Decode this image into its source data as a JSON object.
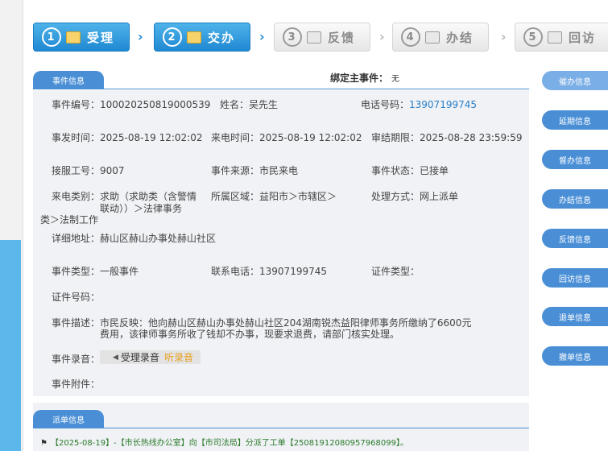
{
  "steps": [
    {
      "num": "1",
      "label": "受理",
      "state": "active"
    },
    {
      "num": "2",
      "label": "交办",
      "state": "active"
    },
    {
      "num": "3",
      "label": "反馈",
      "state": "inactive"
    },
    {
      "num": "4",
      "label": "办结",
      "state": "inactive"
    },
    {
      "num": "5",
      "label": "回访",
      "state": "inactive"
    }
  ],
  "arrow_glyph": "›",
  "sections": {
    "event_info": "事件信息",
    "dispatch_info": "派单信息"
  },
  "binding": {
    "label": "绑定主事件：",
    "value": "无"
  },
  "fields": {
    "event_no": {
      "label": "事件编号：",
      "value": "100020250819000539"
    },
    "name": {
      "label": "姓名：",
      "value": "吴先生"
    },
    "phone": {
      "label": "电话号码：",
      "value": "13907199745"
    },
    "event_time": {
      "label": "事发时间：",
      "value": "2025-08-19 12:02:02"
    },
    "call_time": {
      "label": "来电时间：",
      "value": "2025-08-19 12:02:02"
    },
    "deadline": {
      "label": "审结期限：",
      "value": "2025-08-28 23:59:59"
    },
    "agent_no": {
      "label": "接服工号：",
      "value": "9007"
    },
    "source": {
      "label": "事件来源：",
      "value": "市民来电"
    },
    "status": {
      "label": "事件状态：",
      "value": "已接单"
    },
    "call_type": {
      "label": "来电类别：",
      "value1": "求助（求助类（含警情",
      "value2": "联动））＞法律事务",
      "value3": "类＞法制工作"
    },
    "area": {
      "label": "所属区域：",
      "value1": "益阳市＞市辖区＞"
    },
    "handle_mode": {
      "label": "处理方式：",
      "value": "网上派单"
    },
    "address": {
      "label": "详细地址：",
      "value": "赫山区赫山办事处赫山社区"
    },
    "event_type": {
      "label": "事件类型：",
      "value": "一般事件"
    },
    "contact_phone": {
      "label": "联系电话：",
      "value": "13907199745"
    },
    "id_type": {
      "label": "证件类型：",
      "value": ""
    },
    "id_no": {
      "label": "证件号码：",
      "value": ""
    },
    "description": {
      "label": "事件描述：",
      "line1": "市民反映：他向赫山区赫山办事处赫山社区204湖南锐杰益阳律师事务所缴纳了6600元",
      "line2": "费用，该律师事务所收了钱却不办事，现要求退费，请部门核实处理。"
    },
    "recording": {
      "label": "事件录音：",
      "button": "受理录音",
      "listen": "听录音"
    },
    "attachment": {
      "label": "事件附件：",
      "value": ""
    }
  },
  "dispatch_log": "【2025-08-19】-【市长热线办公室】向【市司法局】分派了工单【25081912080957968099】。",
  "right_buttons": [
    "催办信息",
    "延期信息",
    "督办信息",
    "办结信息",
    "反馈信息",
    "回访信息",
    "退单信息",
    "撤单信息"
  ]
}
